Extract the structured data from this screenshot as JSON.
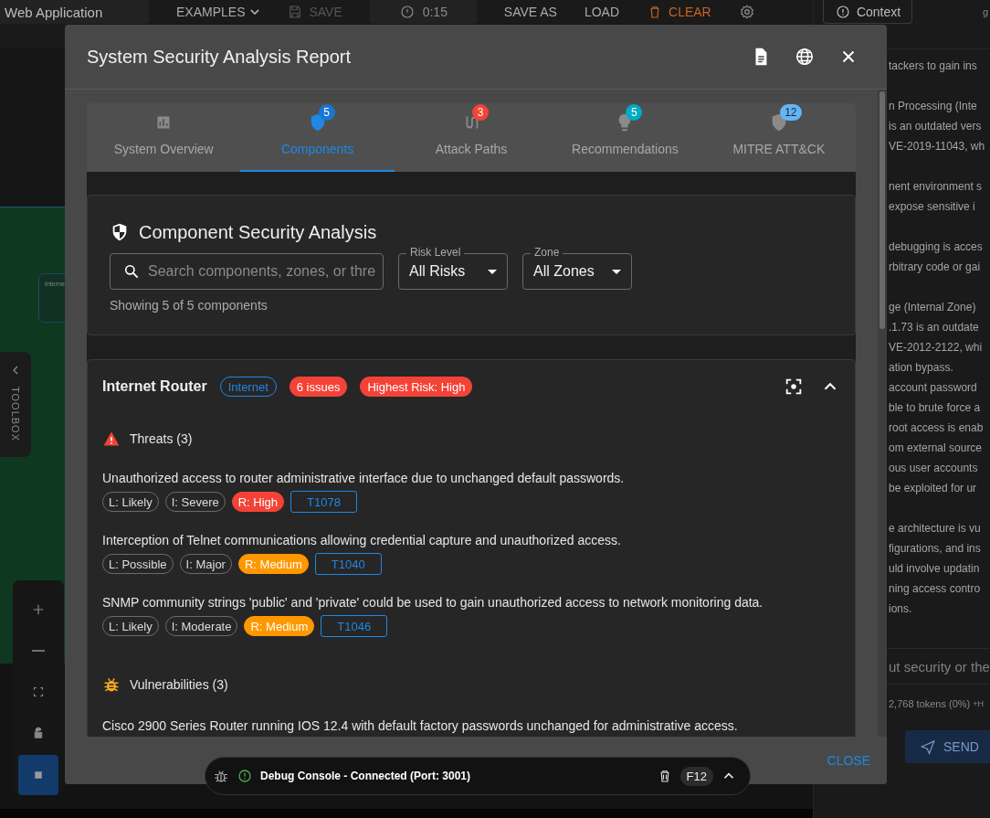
{
  "toolbar": {
    "project": "Web Application",
    "items": [
      {
        "kind": "menu",
        "label": "EXAMPLES",
        "disabled": false
      },
      {
        "kind": "save",
        "label": "SAVE",
        "disabled": true
      },
      {
        "kind": "timer",
        "label": "0:15",
        "disabled": false
      },
      {
        "kind": "text",
        "label": "SAVE AS",
        "disabled": false
      },
      {
        "kind": "text",
        "label": "LOAD",
        "disabled": false
      },
      {
        "kind": "clear",
        "label": "CLEAR",
        "disabled": false
      },
      {
        "kind": "settings",
        "disabled": false
      }
    ]
  },
  "canvas": {
    "node_title": "Interne",
    "toolbox": "TOOLBOX",
    "controls": [
      {
        "kind": "zoom-in",
        "selected": false
      },
      {
        "kind": "zoom-out",
        "selected": false
      },
      {
        "kind": "fit",
        "selected": false
      },
      {
        "kind": "lock",
        "selected": false
      },
      {
        "kind": "stop",
        "selected": true
      }
    ]
  },
  "assistant": {
    "context_button": "Context",
    "header_fragment": "g",
    "paragraphs": [
      [
        "tackers to gain ins"
      ],
      [
        "n Processing (Inte",
        "is an outdated vers",
        "VE-2019-11043, wh"
      ],
      [
        "nent environment s",
        "expose sensitive i"
      ],
      [
        "debugging is acces",
        "rbitrary code or gai"
      ],
      [
        "ge (Internal Zone)",
        ".1.73 is an outdate",
        "VE-2012-2122, whi",
        "ation bypass.",
        "account password",
        "ble to brute force a",
        "root access is enab",
        "om external source",
        "ous user accounts",
        "be exploited for ur"
      ],
      [
        "e architecture is vu",
        "figurations, and ins",
        "uld involve updatin",
        "ning access contro",
        "ions."
      ]
    ],
    "input_placeholder": "ut security or the",
    "tokens": "2,768 tokens (0%)",
    "tokens_extra": "+H",
    "send": "SEND"
  },
  "dialog": {
    "title": "System Security Analysis Report",
    "tabs": [
      {
        "kind": "overview",
        "label": "System Overview",
        "selected": false
      },
      {
        "kind": "components",
        "label": "Components",
        "badge": "5",
        "color": "#1976d2",
        "selected": true
      },
      {
        "kind": "paths",
        "label": "Attack Paths",
        "badge": "3",
        "color": "#f44336",
        "selected": false
      },
      {
        "kind": "recommendations",
        "label": "Recommendations",
        "badge": "5",
        "color": "#00acc1",
        "selected": false
      },
      {
        "kind": "mitre",
        "label": "MITRE ATT&CK",
        "badge": "12",
        "color": "#64b5f6",
        "selected": false
      }
    ],
    "analysis": {
      "title": "Component Security Analysis",
      "search_placeholder": "Search components, zones, or thre",
      "filters": [
        {
          "label": "Risk Level",
          "value": "All Risks"
        },
        {
          "label": "Zone",
          "value": "All Zones"
        }
      ],
      "count": "Showing 5 of 5 components"
    },
    "component": {
      "name": "Internet Router",
      "zone": "Internet",
      "issues": "6 issues",
      "highest": "Highest Risk: High",
      "expanded": true,
      "sections": [
        {
          "kind": "threats",
          "title": "Threats (3)",
          "items": [
            {
              "text": "Unauthorized access to router administrative interface due to unchanged default passwords.",
              "likelihood": "L: Likely",
              "impact": "I: Severe",
              "risk": "R: High",
              "color": "#f44336",
              "technique": "T1078"
            },
            {
              "text": "Interception of Telnet communications allowing credential capture and unauthorized access.",
              "likelihood": "L: Possible",
              "impact": "I: Major",
              "risk": "R: Medium",
              "color": "#ff9800",
              "technique": "T1040"
            },
            {
              "text": "SNMP community strings 'public' and 'private' could be used to gain unauthorized access to network monitoring data.",
              "likelihood": "L: Likely",
              "impact": "I: Moderate",
              "risk": "R: Medium",
              "color": "#ff9800",
              "technique": "T1046"
            }
          ]
        },
        {
          "kind": "vulnerabilities",
          "title": "Vulnerabilities (3)",
          "items": [
            {
              "text": "Cisco 2900 Series Router running IOS 12.4 with default factory passwords unchanged for administrative access."
            }
          ]
        }
      ]
    },
    "close": "CLOSE"
  },
  "debug": {
    "title": "Debug Console - Connected (Port: 3001)",
    "connected": true,
    "shortcut": "F12",
    "expanded": false
  }
}
